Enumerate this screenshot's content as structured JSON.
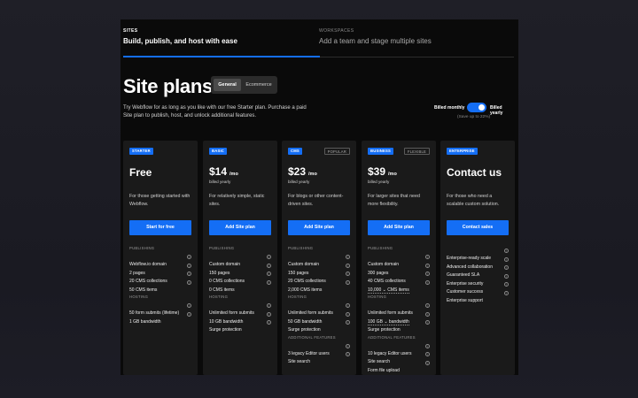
{
  "tabs": [
    {
      "label": "SITES",
      "sub": "Build, publish, and host with ease"
    },
    {
      "label": "WORKSPACES",
      "sub": "Add a team and stage multiple sites"
    }
  ],
  "page_title": "Site plans",
  "segment": {
    "general": "General",
    "ecommerce": "Ecommerce"
  },
  "intro": "Try Webflow for as long as you like with our free Starter plan. Purchase a paid Site plan to publish, host, and unlock additional features.",
  "billing": {
    "monthly": "Billed monthly",
    "yearly": "Billed yearly",
    "save": "(Save up to 22%)"
  },
  "cards": [
    {
      "badge": "STARTER",
      "tag": "",
      "title": "Free",
      "price": "",
      "per": "",
      "billed": "",
      "desc": "For those getting started with Webflow.",
      "cta": "Start for free",
      "sections": [
        {
          "title": "PUBLISHING",
          "items": [
            "Webflow.io domain",
            "2 pages",
            "20 CMS collections",
            "50 CMS items"
          ]
        },
        {
          "title": "HOSTING",
          "items": [
            "50 form submits (lifetime)",
            "1 GB bandwidth"
          ]
        }
      ]
    },
    {
      "badge": "BASIC",
      "tag": "",
      "title": "",
      "price": "$14",
      "per": "/mo",
      "billed": "billed yearly",
      "desc": "For relatively simple, static sites.",
      "cta": "Add Site plan",
      "sections": [
        {
          "title": "PUBLISHING",
          "items": [
            "Custom domain",
            "150 pages",
            "0 CMS collections",
            "0 CMS items"
          ]
        },
        {
          "title": "HOSTING",
          "items": [
            "Unlimited form submits",
            "10 GB bandwidth",
            "Surge protection"
          ]
        }
      ]
    },
    {
      "badge": "CMS",
      "tag": "POPULAR",
      "title": "",
      "price": "$23",
      "per": "/mo",
      "billed": "billed yearly",
      "desc": "For blogs or other content-driven sites.",
      "cta": "Add Site plan",
      "sections": [
        {
          "title": "PUBLISHING",
          "items": [
            "Custom domain",
            "150 pages",
            "20 CMS collections",
            "2,000 CMS items"
          ]
        },
        {
          "title": "HOSTING",
          "items": [
            "Unlimited form submits",
            "50 GB bandwidth",
            "Surge protection"
          ]
        },
        {
          "title": "ADDITIONAL FEATURES",
          "items": [
            "3 legacy Editor users",
            "Site search"
          ]
        }
      ]
    },
    {
      "badge": "BUSINESS",
      "tag": "FLEXIBLE",
      "title": "",
      "price": "$39",
      "per": "/mo",
      "billed": "billed yearly",
      "desc": "For larger sites that need more flexibility.",
      "cta": "Add Site plan",
      "sections": [
        {
          "title": "PUBLISHING",
          "items": [
            "Custom domain",
            "300 pages",
            "40 CMS collections",
            "10,000 ⌄ CMS items"
          ]
        },
        {
          "title": "HOSTING",
          "items": [
            "Unlimited form submits",
            "100 GB ⌄ bandwidth",
            "Surge protection"
          ]
        },
        {
          "title": "ADDITIONAL FEATURES",
          "items": [
            "10 legacy Editor users",
            "Site search",
            "Form file upload"
          ]
        }
      ]
    },
    {
      "badge": "ENTERPRISE",
      "tag": "",
      "title": "Contact us",
      "price": "",
      "per": "",
      "billed": "",
      "desc": "For those who need a scalable custom solution.",
      "cta": "Contact sales",
      "sections": [
        {
          "title": "",
          "items": [
            "Enterprise-ready scale",
            "Advanced collaboration",
            "Guaranteed SLA",
            "Enterprise security",
            "Customer success",
            "Enterprise support"
          ]
        }
      ]
    }
  ],
  "colors": {
    "accent": "#146ef5",
    "card": "#1a1a1a",
    "frame": "#0a0a0a"
  },
  "icons": {
    "info": "info-circle-icon"
  }
}
